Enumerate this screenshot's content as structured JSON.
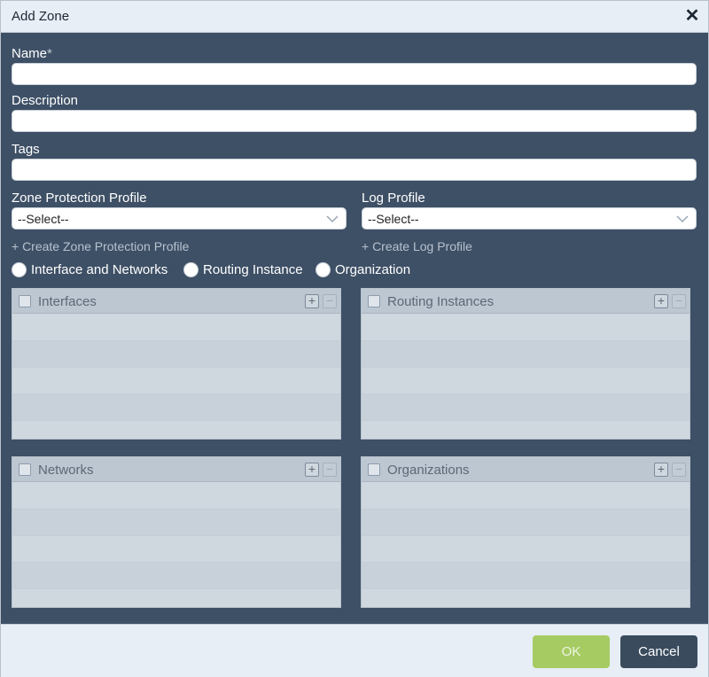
{
  "dialog": {
    "title": "Add Zone",
    "close_glyph": "✕"
  },
  "form": {
    "name_label": "Name",
    "required_mark": "*",
    "name_value": "",
    "description_label": "Description",
    "description_value": "",
    "tags_label": "Tags",
    "tags_value": "",
    "zone_protection_label": "Zone Protection Profile",
    "zone_protection_selected": "--Select--",
    "log_profile_label": "Log Profile",
    "log_profile_selected": "--Select--",
    "create_zone_protection_link": "+ Create Zone Protection Profile",
    "create_log_profile_link": "+ Create Log Profile"
  },
  "radio_options": [
    {
      "label": "Interface and Networks",
      "selected": false
    },
    {
      "label": "Routing Instance",
      "selected": false
    },
    {
      "label": "Organization",
      "selected": false
    }
  ],
  "grids": {
    "interfaces": {
      "title": "Interfaces"
    },
    "routing_instances": {
      "title": "Routing Instances"
    },
    "networks": {
      "title": "Networks"
    },
    "organizations": {
      "title": "Organizations"
    },
    "add_glyph": "+",
    "remove_glyph": "−"
  },
  "footer": {
    "ok_label": "OK",
    "cancel_label": "Cancel"
  },
  "colors": {
    "body_bg": "#3e5066",
    "ok_button": "#a7cb63",
    "cancel_button": "#3a4b5e"
  }
}
